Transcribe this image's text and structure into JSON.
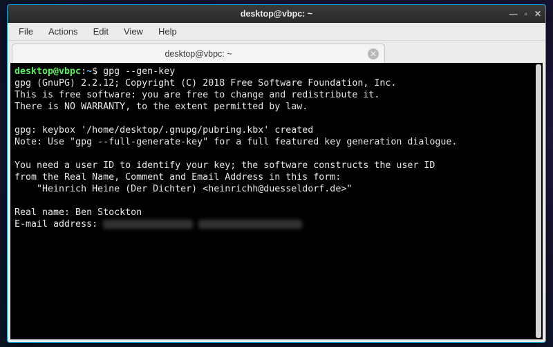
{
  "titlebar": {
    "title": "desktop@vbpc: ~"
  },
  "menu": {
    "file": "File",
    "actions": "Actions",
    "edit": "Edit",
    "view": "View",
    "help": "Help"
  },
  "tab": {
    "label": "desktop@vbpc: ~"
  },
  "prompt": {
    "user": "desktop@vbpc",
    "sep": ":",
    "path": "~",
    "dollar": "$"
  },
  "command": " gpg --gen-key",
  "output": {
    "l1": "gpg (GnuPG) 2.2.12; Copyright (C) 2018 Free Software Foundation, Inc.",
    "l2": "This is free software: you are free to change and redistribute it.",
    "l3": "There is NO WARRANTY, to the extent permitted by law.",
    "l4": "",
    "l5": "gpg: keybox '/home/desktop/.gnupg/pubring.kbx' created",
    "l6": "Note: Use \"gpg --full-generate-key\" for a full featured key generation dialogue.",
    "l7": "",
    "l8": "You need a user ID to identify your key; the software constructs the user ID",
    "l9": "from the Real Name, Comment and Email Address in this form:",
    "l10": "    \"Heinrich Heine (Der Dichter) <heinrichh@duesseldorf.de>\"",
    "l11": "",
    "l12": "Real name: Ben Stockton",
    "l13_prefix": "E-mail address: "
  }
}
